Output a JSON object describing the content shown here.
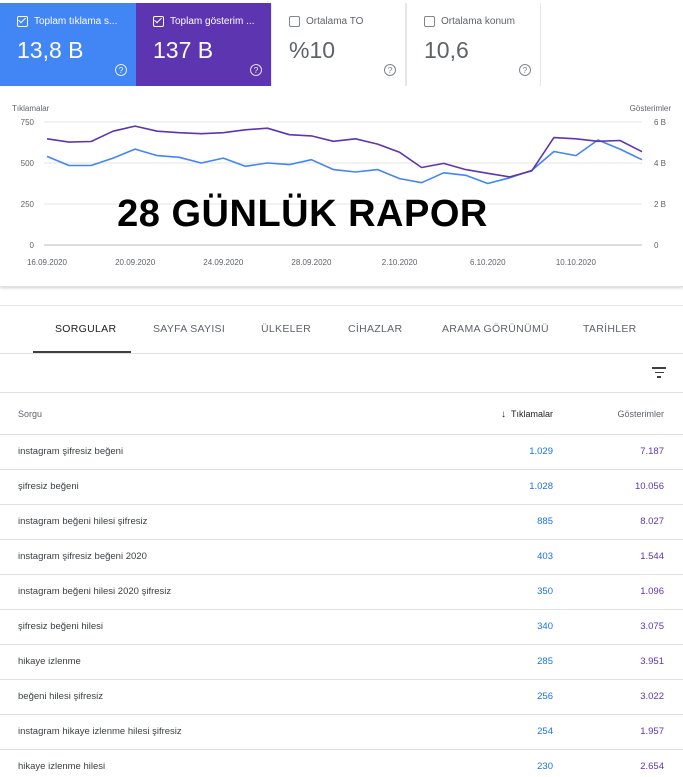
{
  "cards": [
    {
      "label": "Toplam tıklama s...",
      "value": "13,8 B",
      "checked": true
    },
    {
      "label": "Toplam gösterim ...",
      "value": "137 B",
      "checked": true
    },
    {
      "label": "Ortalama TO",
      "value": "%10",
      "checked": false
    },
    {
      "label": "Ortalama konum",
      "value": "10,6",
      "checked": false
    }
  ],
  "help_glyph": "?",
  "colors": {
    "clicks": "#4285f4",
    "impressions": "#5e35b1"
  },
  "chart_data": {
    "type": "line",
    "xlabel": "",
    "y_left_label": "Tıklamalar",
    "y_right_label": "Gösterimler",
    "y_left_ticks": [
      "0",
      "250",
      "500",
      "750"
    ],
    "y_left_range": [
      0,
      750
    ],
    "y_right_ticks": [
      "0",
      "2 B",
      "4 B",
      "6 B"
    ],
    "y_right_range": [
      0,
      6000
    ],
    "x_tick_labels": [
      "16.09.2020",
      "20.09.2020",
      "24.09.2020",
      "28.09.2020",
      "2.10.2020",
      "6.10.2020",
      "10.10.2020"
    ],
    "x_tick_positions": [
      0,
      4,
      8,
      12,
      16,
      20,
      24
    ],
    "n_points": 28,
    "grid": true,
    "series": [
      {
        "name": "Tıklamalar",
        "axis": "left",
        "color": "#4285f4",
        "values": [
          540,
          485,
          485,
          530,
          585,
          545,
          535,
          500,
          530,
          480,
          500,
          490,
          520,
          460,
          445,
          460,
          405,
          380,
          440,
          425,
          375,
          410,
          455,
          570,
          545,
          640,
          585,
          520
        ]
      },
      {
        "name": "Gösterimler",
        "axis": "right",
        "color": "#5e35b1",
        "values": [
          5180,
          5020,
          5050,
          5550,
          5800,
          5550,
          5480,
          5430,
          5480,
          5620,
          5700,
          5380,
          5320,
          5060,
          5180,
          4920,
          4520,
          3780,
          3980,
          3680,
          3500,
          3320,
          3620,
          5240,
          5180,
          5060,
          5100,
          4550
        ]
      }
    ]
  },
  "overlay_title": "28 GÜNLÜK RAPOR",
  "tabs": [
    {
      "label": "SORGULAR",
      "active": true
    },
    {
      "label": "SAYFA SAYISI",
      "active": false
    },
    {
      "label": "ÜLKELER",
      "active": false
    },
    {
      "label": "CİHAZLAR",
      "active": false
    },
    {
      "label": "ARAMA GÖRÜNÜMÜ",
      "active": false
    },
    {
      "label": "TARİHLER",
      "active": false
    }
  ],
  "table": {
    "headers": {
      "query": "Sorgu",
      "clicks": "Tıklamalar",
      "impressions": "Gösterimler"
    },
    "sort_glyph": "↓",
    "rows": [
      {
        "query": "instagram şifresiz beğeni",
        "clicks": "1.029",
        "impressions": "7.187"
      },
      {
        "query": "şifresiz beğeni",
        "clicks": "1.028",
        "impressions": "10.056"
      },
      {
        "query": "instagram beğeni hilesi şifresiz",
        "clicks": "885",
        "impressions": "8.027"
      },
      {
        "query": "instagram şifresiz beğeni 2020",
        "clicks": "403",
        "impressions": "1.544"
      },
      {
        "query": "instagram beğeni hilesi 2020 şifresiz",
        "clicks": "350",
        "impressions": "1.096"
      },
      {
        "query": "şifresiz beğeni hilesi",
        "clicks": "340",
        "impressions": "3.075"
      },
      {
        "query": "hikaye izlenme",
        "clicks": "285",
        "impressions": "3.951"
      },
      {
        "query": "beğeni hilesi şifresiz",
        "clicks": "256",
        "impressions": "3.022"
      },
      {
        "query": "instagram hikaye izlenme hilesi şifresiz",
        "clicks": "254",
        "impressions": "1.957"
      },
      {
        "query": "hikaye izlenme hilesi",
        "clicks": "230",
        "impressions": "2.654"
      }
    ]
  }
}
